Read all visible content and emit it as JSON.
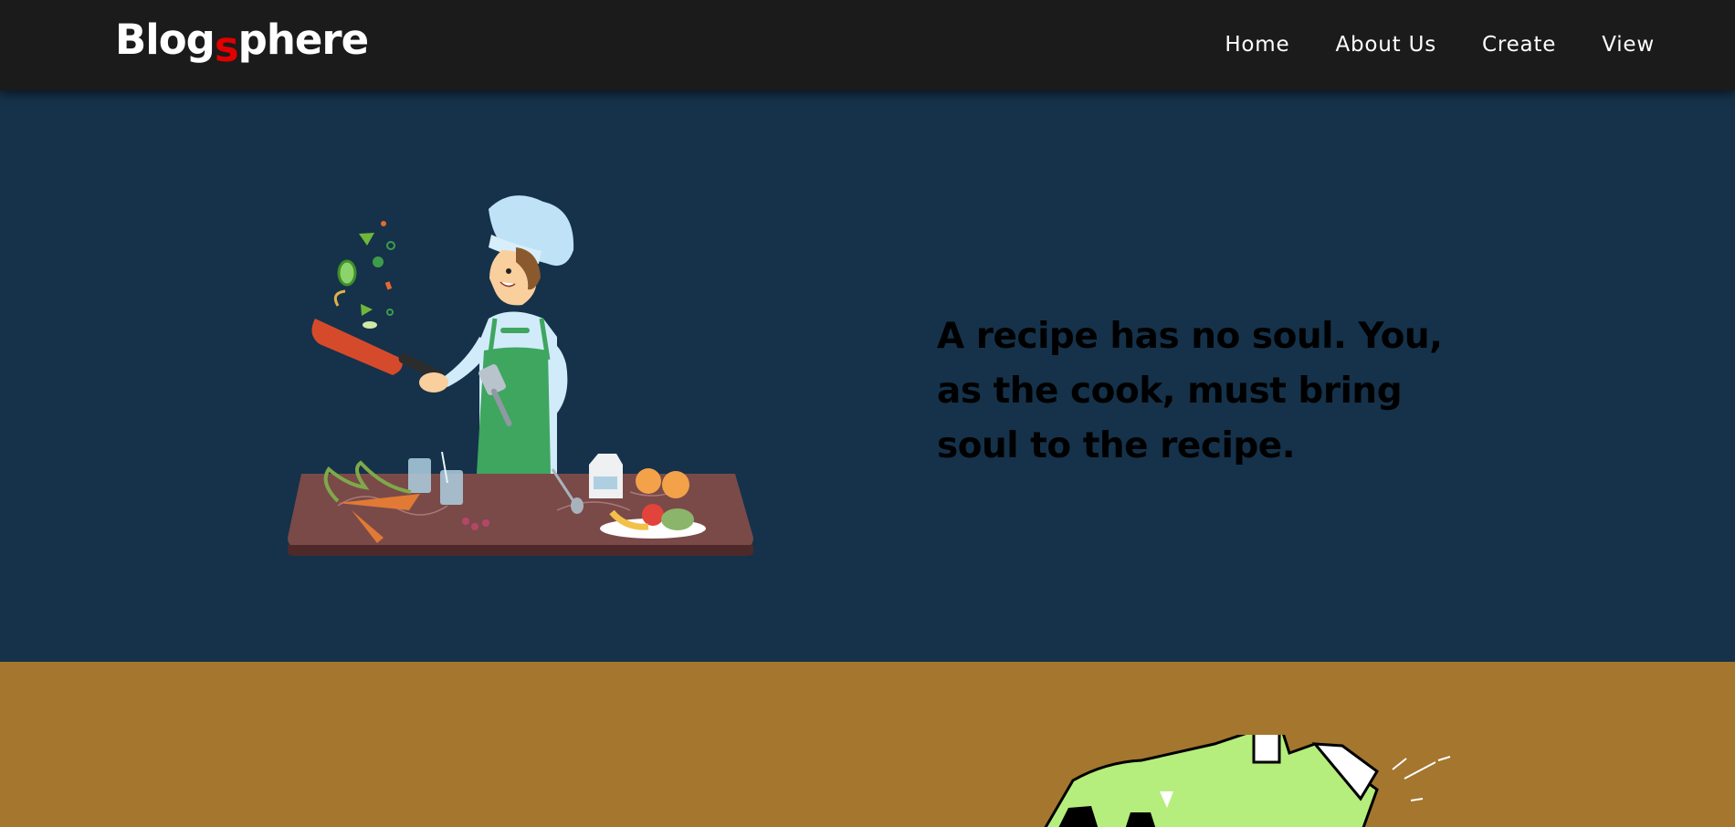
{
  "brand": {
    "name_part1": "Blog",
    "name_accent": "s",
    "name_part2": "phere",
    "accent_color": "#e00000"
  },
  "nav": {
    "items": [
      {
        "label": "Home"
      },
      {
        "label": "About Us"
      },
      {
        "label": "Create"
      },
      {
        "label": "View"
      }
    ]
  },
  "hero": {
    "quote": "A recipe has no soul. You, as the cook, must bring soul to the recipe.",
    "illustration": "chef-cooking-illustration",
    "background_color": "#15324a"
  },
  "section_two": {
    "background_color": "#a4762e",
    "illustration": "green-cartoon-illustration"
  },
  "colors": {
    "header_bg": "#1b1b1b",
    "text_light": "#ffffff",
    "quote_text": "#000000"
  }
}
